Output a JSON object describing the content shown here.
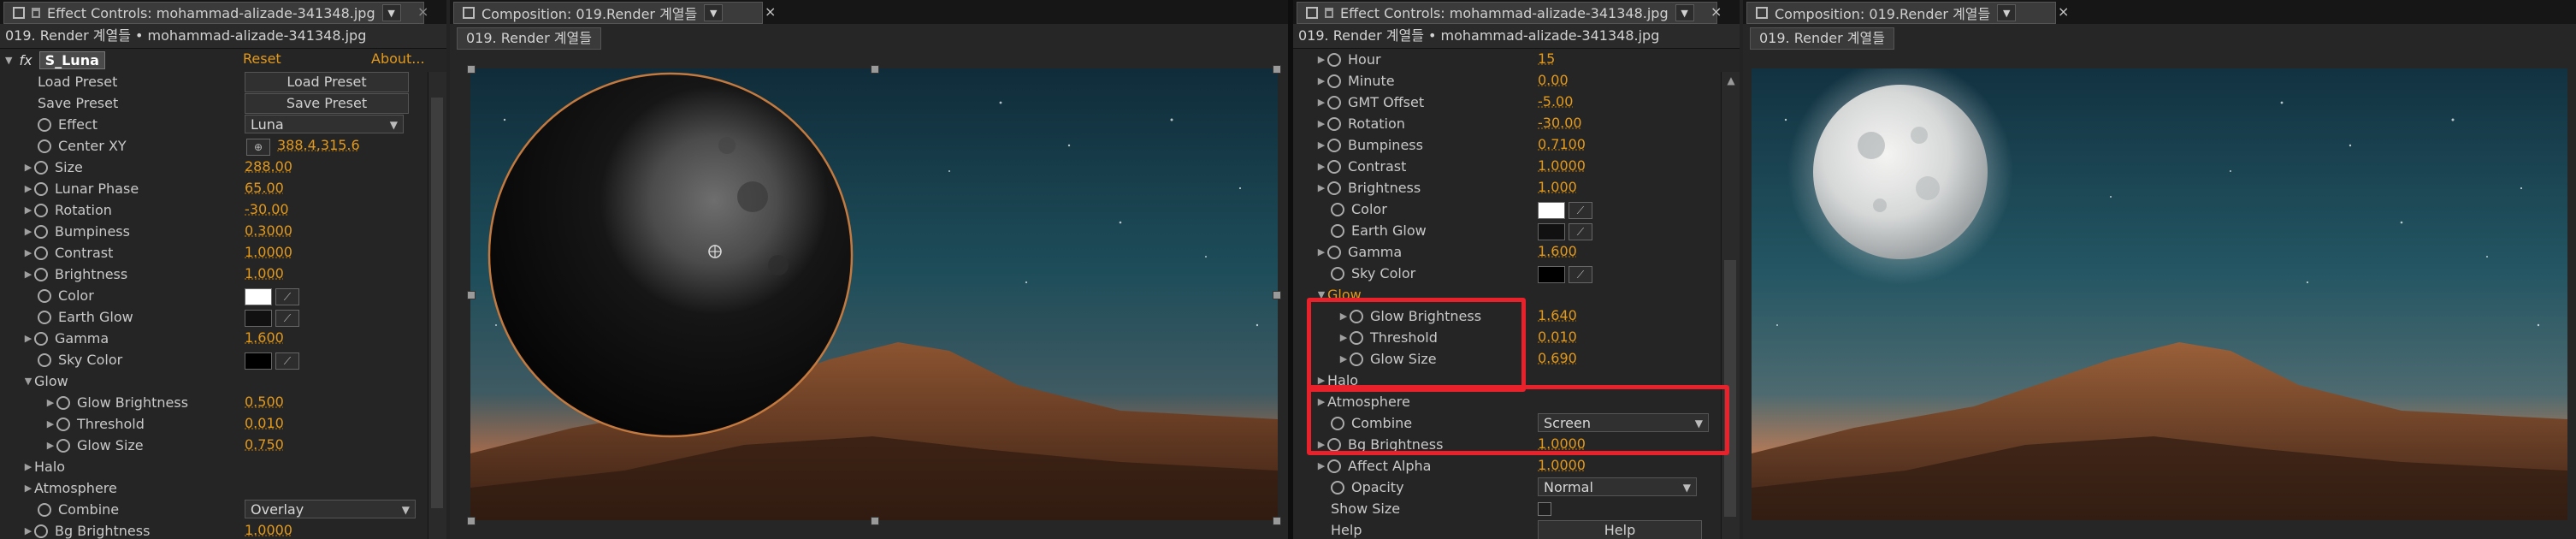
{
  "left": {
    "ec_tab": {
      "title": "Effect Controls: mohammad-alizade-341348.jpg"
    },
    "ec_header": "019. Render 계열들 • mohammad-alizade-341348.jpg",
    "fx": {
      "label": "fx",
      "name": "S_Luna",
      "reset": "Reset",
      "about": "About..."
    },
    "load_preset": {
      "label": "Load Preset",
      "button": "Load Preset"
    },
    "save_preset": {
      "label": "Save Preset",
      "button": "Save Preset"
    },
    "params": {
      "effect": {
        "label": "Effect",
        "value": "Luna"
      },
      "center": {
        "label": "Center XY",
        "value": "388.4,315.6"
      },
      "size": {
        "label": "Size",
        "value": "288.00"
      },
      "lunar_phase": {
        "label": "Lunar Phase",
        "value": "65.00"
      },
      "rotation": {
        "label": "Rotation",
        "value": "-30.00"
      },
      "bumpiness": {
        "label": "Bumpiness",
        "value": "0.3000"
      },
      "contrast": {
        "label": "Contrast",
        "value": "1.0000"
      },
      "brightness": {
        "label": "Brightness",
        "value": "1.000"
      },
      "color": {
        "label": "Color",
        "swatch": "#ffffff"
      },
      "earth_glow": {
        "label": "Earth Glow",
        "swatch": "#111111"
      },
      "gamma": {
        "label": "Gamma",
        "value": "1.600"
      },
      "sky_color": {
        "label": "Sky Color",
        "swatch": "#000000"
      },
      "glow": {
        "label": "Glow"
      },
      "glow_brightness": {
        "label": "Glow Brightness",
        "value": "0.500"
      },
      "threshold": {
        "label": "Threshold",
        "value": "0.010"
      },
      "glow_size": {
        "label": "Glow Size",
        "value": "0.750"
      },
      "halo": {
        "label": "Halo"
      },
      "atmosphere": {
        "label": "Atmosphere"
      },
      "combine": {
        "label": "Combine",
        "value": "Overlay"
      },
      "bg_brightness": {
        "label": "Bg Brightness",
        "value": "1.0000"
      }
    },
    "comp_tab": {
      "title": "Composition: 019.Render 계열들"
    },
    "comp_header": "019. Render 계열들"
  },
  "right": {
    "ec_tab": {
      "title": "Effect Controls: mohammad-alizade-341348.jpg"
    },
    "ec_header": "019. Render 계열들 • mohammad-alizade-341348.jpg",
    "params": {
      "hour": {
        "label": "Hour",
        "value": "15"
      },
      "minute": {
        "label": "Minute",
        "value": "0.00"
      },
      "gmt": {
        "label": "GMT Offset",
        "value": "-5.00"
      },
      "rotation": {
        "label": "Rotation",
        "value": "-30.00"
      },
      "bumpiness": {
        "label": "Bumpiness",
        "value": "0.7100"
      },
      "contrast": {
        "label": "Contrast",
        "value": "1.0000"
      },
      "brightness": {
        "label": "Brightness",
        "value": "1.000"
      },
      "color": {
        "label": "Color",
        "swatch": "#ffffff"
      },
      "earth_glow": {
        "label": "Earth Glow",
        "swatch": "#111111"
      },
      "gamma": {
        "label": "Gamma",
        "value": "1.600"
      },
      "sky_color": {
        "label": "Sky Color",
        "swatch": "#000000"
      },
      "glow": {
        "label": "Glow"
      },
      "glow_brightness": {
        "label": "Glow Brightness",
        "value": "1.640"
      },
      "threshold": {
        "label": "Threshold",
        "value": "0.010"
      },
      "glow_size": {
        "label": "Glow Size",
        "value": "0.690"
      },
      "halo": {
        "label": "Halo"
      },
      "atmosphere": {
        "label": "Atmosphere"
      },
      "combine": {
        "label": "Combine",
        "value": "Screen"
      },
      "bg_brightness": {
        "label": "Bg Brightness",
        "value": "1.0000"
      },
      "affect_alpha": {
        "label": "Affect Alpha",
        "value": "1.0000"
      },
      "opacity": {
        "label": "Opacity",
        "value": "Normal"
      },
      "show_size": {
        "label": "Show Size"
      },
      "help": {
        "label": "Help",
        "button": "Help"
      }
    },
    "comp_tab": {
      "title": "Composition: 019.Render 계열들"
    },
    "comp_header": "019. Render 계열들"
  },
  "colors": {
    "accent_value": "#e39a1c",
    "highlight_box": "#e8212a"
  }
}
